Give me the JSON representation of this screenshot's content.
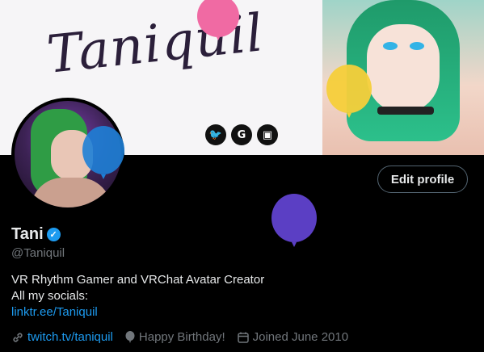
{
  "banner": {
    "title": "Taniquil",
    "social_icons": [
      "twitter-icon",
      "google-icon",
      "twitch-icon"
    ]
  },
  "profile": {
    "name": "Tani",
    "handle": "@Taniquil",
    "edit_label": "Edit profile",
    "bio_line1": "VR Rhythm Gamer and VRChat Avatar Creator",
    "bio_line2": "All my socials:",
    "bio_link": "linktr.ee/Taniquil",
    "website": "twitch.tv/taniquil",
    "birthday": "Happy Birthday!",
    "joined": "Joined June 2010"
  },
  "colors": {
    "accent": "#1d9bf0",
    "muted": "#71767b",
    "balloon_pink": "#f06aa3",
    "balloon_yellow": "#f5cf3a",
    "balloon_purple": "#5b3fc4",
    "balloon_blue": "#1e7fd6"
  }
}
